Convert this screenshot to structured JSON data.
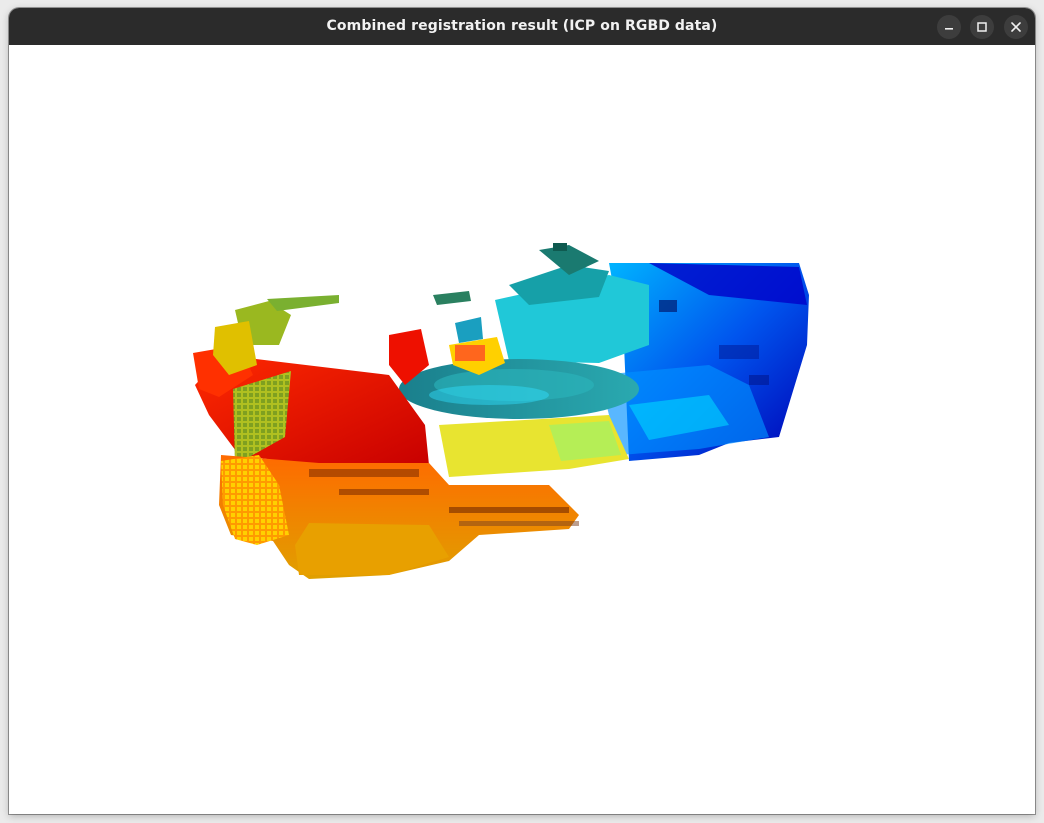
{
  "window": {
    "title": "Combined registration result (ICP on RGBD data)"
  },
  "window_controls": {
    "minimize_icon": "minimize-icon",
    "maximize_icon": "maximize-icon",
    "close_icon": "close-icon"
  },
  "colors": {
    "titlebar": "#2b2b2b",
    "title_text": "#f2f2f2",
    "canvas_background": "#ffffff",
    "colormap": [
      "#0000b4",
      "#0066ff",
      "#00e5ff",
      "#1e8c96",
      "#d8f040",
      "#ffd200",
      "#ff8c00",
      "#ff1400",
      "#b40000"
    ]
  }
}
